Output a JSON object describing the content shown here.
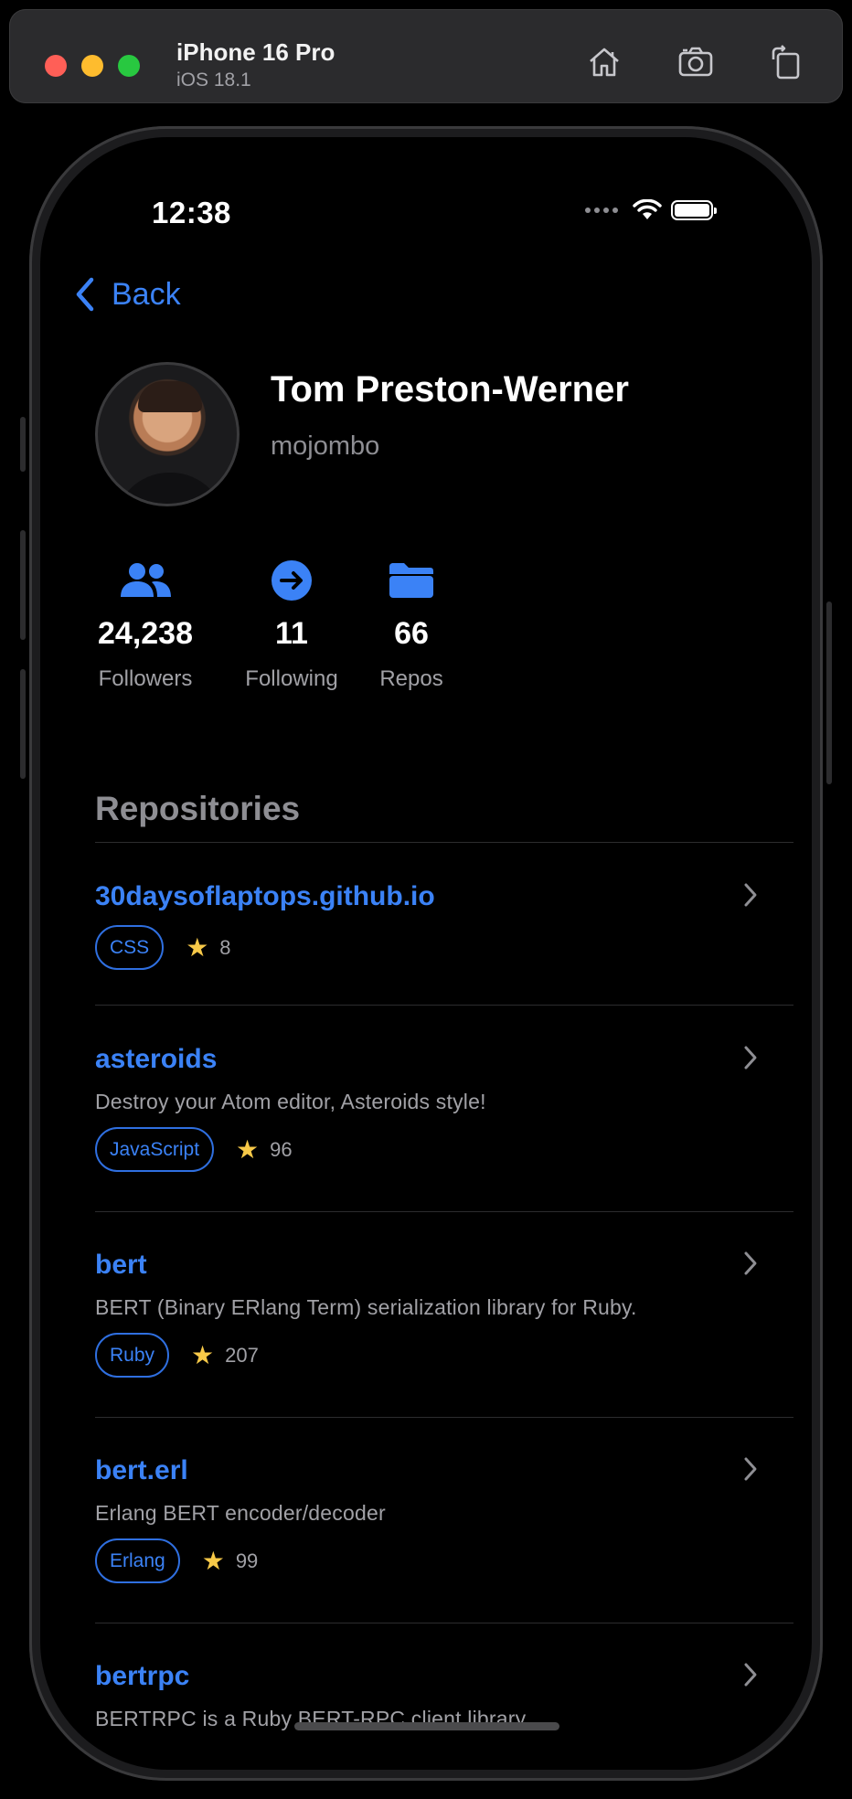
{
  "simulator": {
    "device_name": "iPhone 16 Pro",
    "os_version": "iOS 18.1",
    "buttons": {
      "home": "home-icon",
      "screenshot": "camera-icon",
      "rotate": "rotate-icon"
    }
  },
  "status_bar": {
    "time": "12:38"
  },
  "nav": {
    "back_label": "Back"
  },
  "profile": {
    "name": "Tom Preston-Werner",
    "login": "mojombo",
    "stats": [
      {
        "icon": "people-icon",
        "value": "24,238",
        "label": "Followers"
      },
      {
        "icon": "arrow-circle-icon",
        "value": "11",
        "label": "Following"
      },
      {
        "icon": "folder-icon",
        "value": "66",
        "label": "Repos"
      }
    ]
  },
  "repositories": {
    "title": "Repositories",
    "items": [
      {
        "name": "30daysoflaptops.github.io",
        "description": "",
        "language": "CSS",
        "stars": "8"
      },
      {
        "name": "asteroids",
        "description": "Destroy your Atom editor, Asteroids style!",
        "language": "JavaScript",
        "stars": "96"
      },
      {
        "name": "bert",
        "description": "BERT (Binary ERlang Term) serialization library for Ruby.",
        "language": "Ruby",
        "stars": "207"
      },
      {
        "name": "bert.erl",
        "description": "Erlang BERT encoder/decoder",
        "language": "Erlang",
        "stars": "99"
      },
      {
        "name": "bertrpc",
        "description": "BERTRPC is a Ruby BERT-RPC client library.",
        "language": "",
        "stars": ""
      }
    ]
  },
  "colors": {
    "accent": "#3b82f6",
    "star": "#f7c948",
    "secondary_text": "#a1a1a6",
    "background": "#000000"
  }
}
